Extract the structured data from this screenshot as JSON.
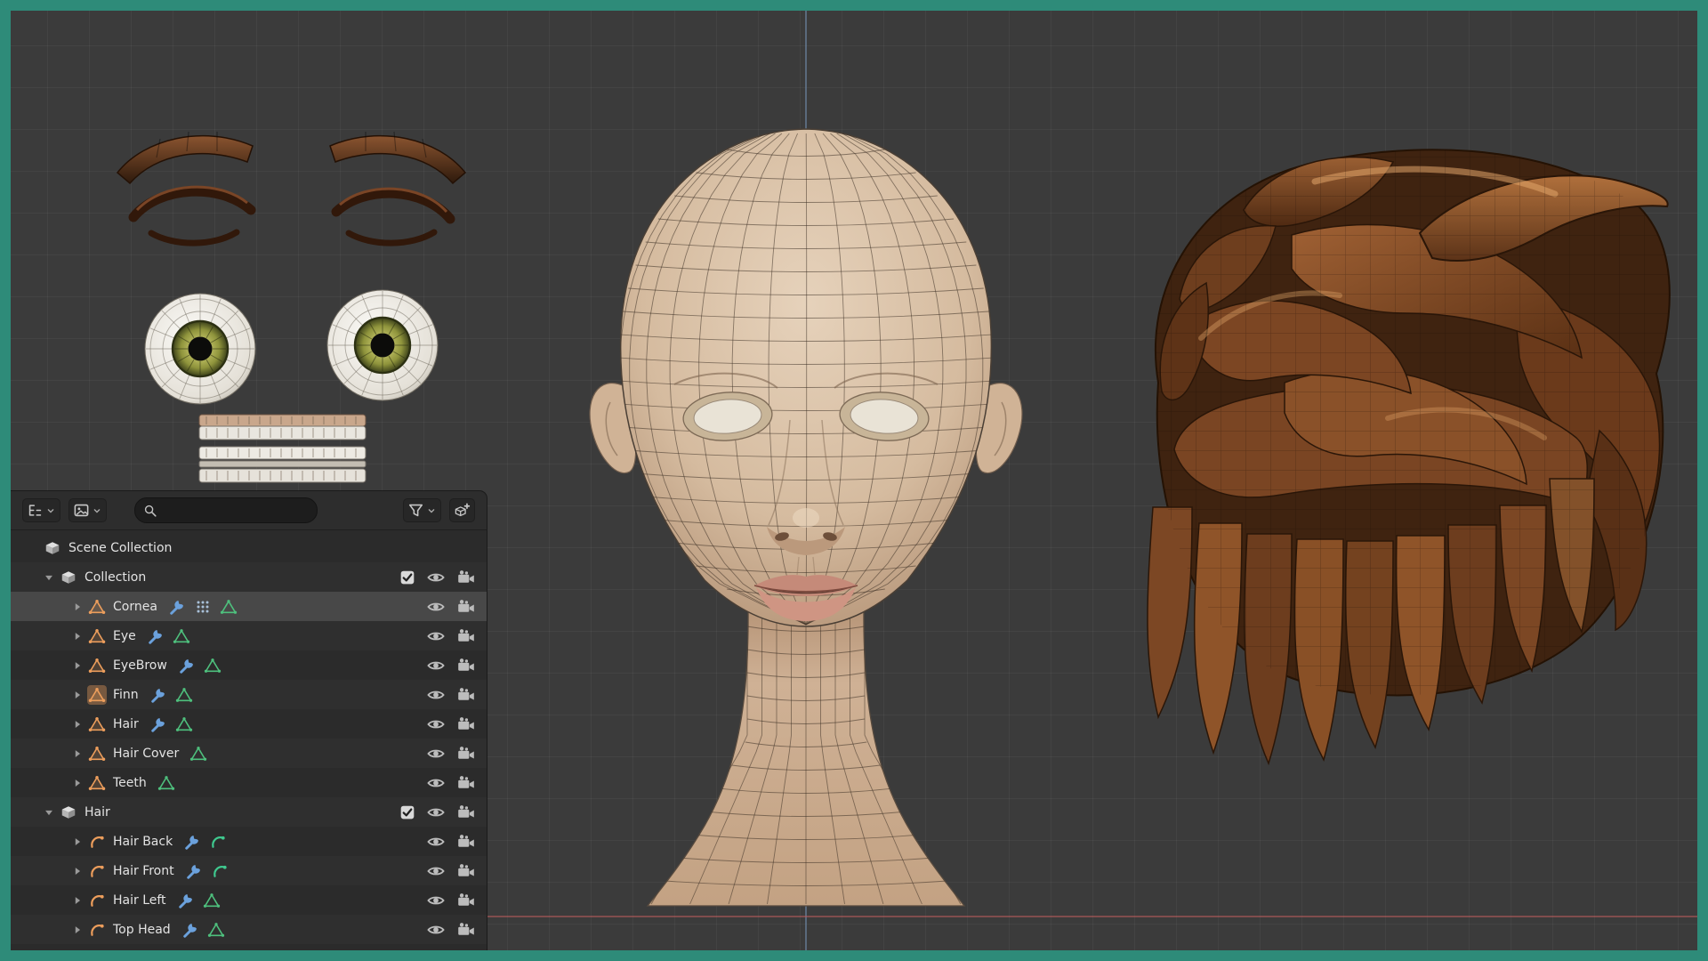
{
  "app": "blender-3d-viewport",
  "window": {
    "frame_color": "#2e8b79",
    "viewport_bg": "#3b3b3b"
  },
  "viewport": {
    "grid_color": "#474747",
    "axis_vertical_color": "#7898be",
    "axis_horizontal_color": "#ba5c5c",
    "meshes": [
      "eyebrows",
      "eyelashes",
      "eyeballs",
      "teeth",
      "head",
      "hair"
    ]
  },
  "outliner": {
    "header": {
      "icons": [
        "editor-type-icon",
        "display-mode-icon",
        "search-icon",
        "filter-icon",
        "new-collection-icon"
      ],
      "search": {
        "placeholder": "",
        "value": ""
      }
    },
    "rows": [
      {
        "label": "Scene Collection",
        "icon": "scene-collection",
        "depth": 0,
        "arrow": "none",
        "eye": false,
        "camera": false
      },
      {
        "label": "Collection",
        "icon": "collection",
        "depth": 1,
        "arrow": "down",
        "checkbox": true,
        "eye": true,
        "camera": true
      },
      {
        "label": "Cornea",
        "icon": "mesh",
        "depth": 2,
        "arrow": "right",
        "selected": true,
        "badges": [
          "wrench",
          "particles",
          "mesh-data"
        ],
        "eye": true,
        "camera": true
      },
      {
        "label": "Eye",
        "icon": "mesh",
        "depth": 2,
        "arrow": "right",
        "badges": [
          "wrench",
          "mesh-data"
        ],
        "eye": true,
        "camera": true
      },
      {
        "label": "EyeBrow",
        "icon": "mesh",
        "depth": 2,
        "arrow": "right",
        "badges": [
          "wrench",
          "mesh-data"
        ],
        "eye": true,
        "camera": true
      },
      {
        "label": "Finn",
        "icon": "mesh",
        "depth": 2,
        "arrow": "right",
        "active": true,
        "badges": [
          "wrench",
          "mesh-data"
        ],
        "eye": true,
        "camera": true
      },
      {
        "label": "Hair",
        "icon": "mesh",
        "depth": 2,
        "arrow": "right",
        "badges": [
          "wrench",
          "mesh-data"
        ],
        "eye": true,
        "camera": true
      },
      {
        "label": "Hair Cover",
        "icon": "mesh",
        "depth": 2,
        "arrow": "right",
        "badges": [
          "mesh-data"
        ],
        "eye": true,
        "camera": true
      },
      {
        "label": "Teeth",
        "icon": "mesh",
        "depth": 2,
        "arrow": "right",
        "badges": [
          "mesh-data"
        ],
        "eye": true,
        "camera": true
      },
      {
        "label": "Hair",
        "icon": "collection",
        "depth": 1,
        "arrow": "down",
        "checkbox": true,
        "eye": true,
        "camera": true
      },
      {
        "label": "Hair Back",
        "icon": "curve",
        "depth": 2,
        "arrow": "right",
        "badges": [
          "wrench",
          "curve-data"
        ],
        "eye": true,
        "camera": true
      },
      {
        "label": "Hair Front",
        "icon": "curve",
        "depth": 2,
        "arrow": "right",
        "badges": [
          "wrench",
          "curve-data"
        ],
        "eye": true,
        "camera": true
      },
      {
        "label": "Hair Left",
        "icon": "curve",
        "depth": 2,
        "arrow": "right",
        "badges": [
          "wrench",
          "mesh-data"
        ],
        "eye": true,
        "camera": true
      },
      {
        "label": "Top Head",
        "icon": "curve",
        "depth": 2,
        "arrow": "right",
        "badges": [
          "wrench",
          "mesh-data"
        ],
        "eye": true,
        "camera": true
      }
    ]
  },
  "colors": {
    "accent_orange": "#ed9e5c",
    "wrench_blue": "#6ba1dc",
    "data_green": "#4ec07d",
    "selection_gray": "#484848"
  }
}
